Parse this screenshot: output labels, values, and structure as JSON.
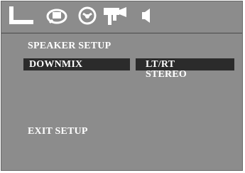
{
  "topbar": {
    "tabs": [
      {
        "icon": "general-setup-icon"
      },
      {
        "icon": "audio-setup-icon"
      },
      {
        "icon": "dolby-digital-icon"
      },
      {
        "icon": "video-setup-icon"
      },
      {
        "icon": "speaker-icon"
      }
    ]
  },
  "page": {
    "title": "SPEAKER SETUP",
    "menu_item": "DOWNMIX",
    "selected_value": "LT/RT",
    "options": [
      "LT/RT",
      "STEREO"
    ],
    "exit_label": "EXIT SETUP"
  },
  "colors": {
    "background": "#8c8c8c",
    "highlight": "#2b2b2b",
    "text": "#ffffff"
  }
}
